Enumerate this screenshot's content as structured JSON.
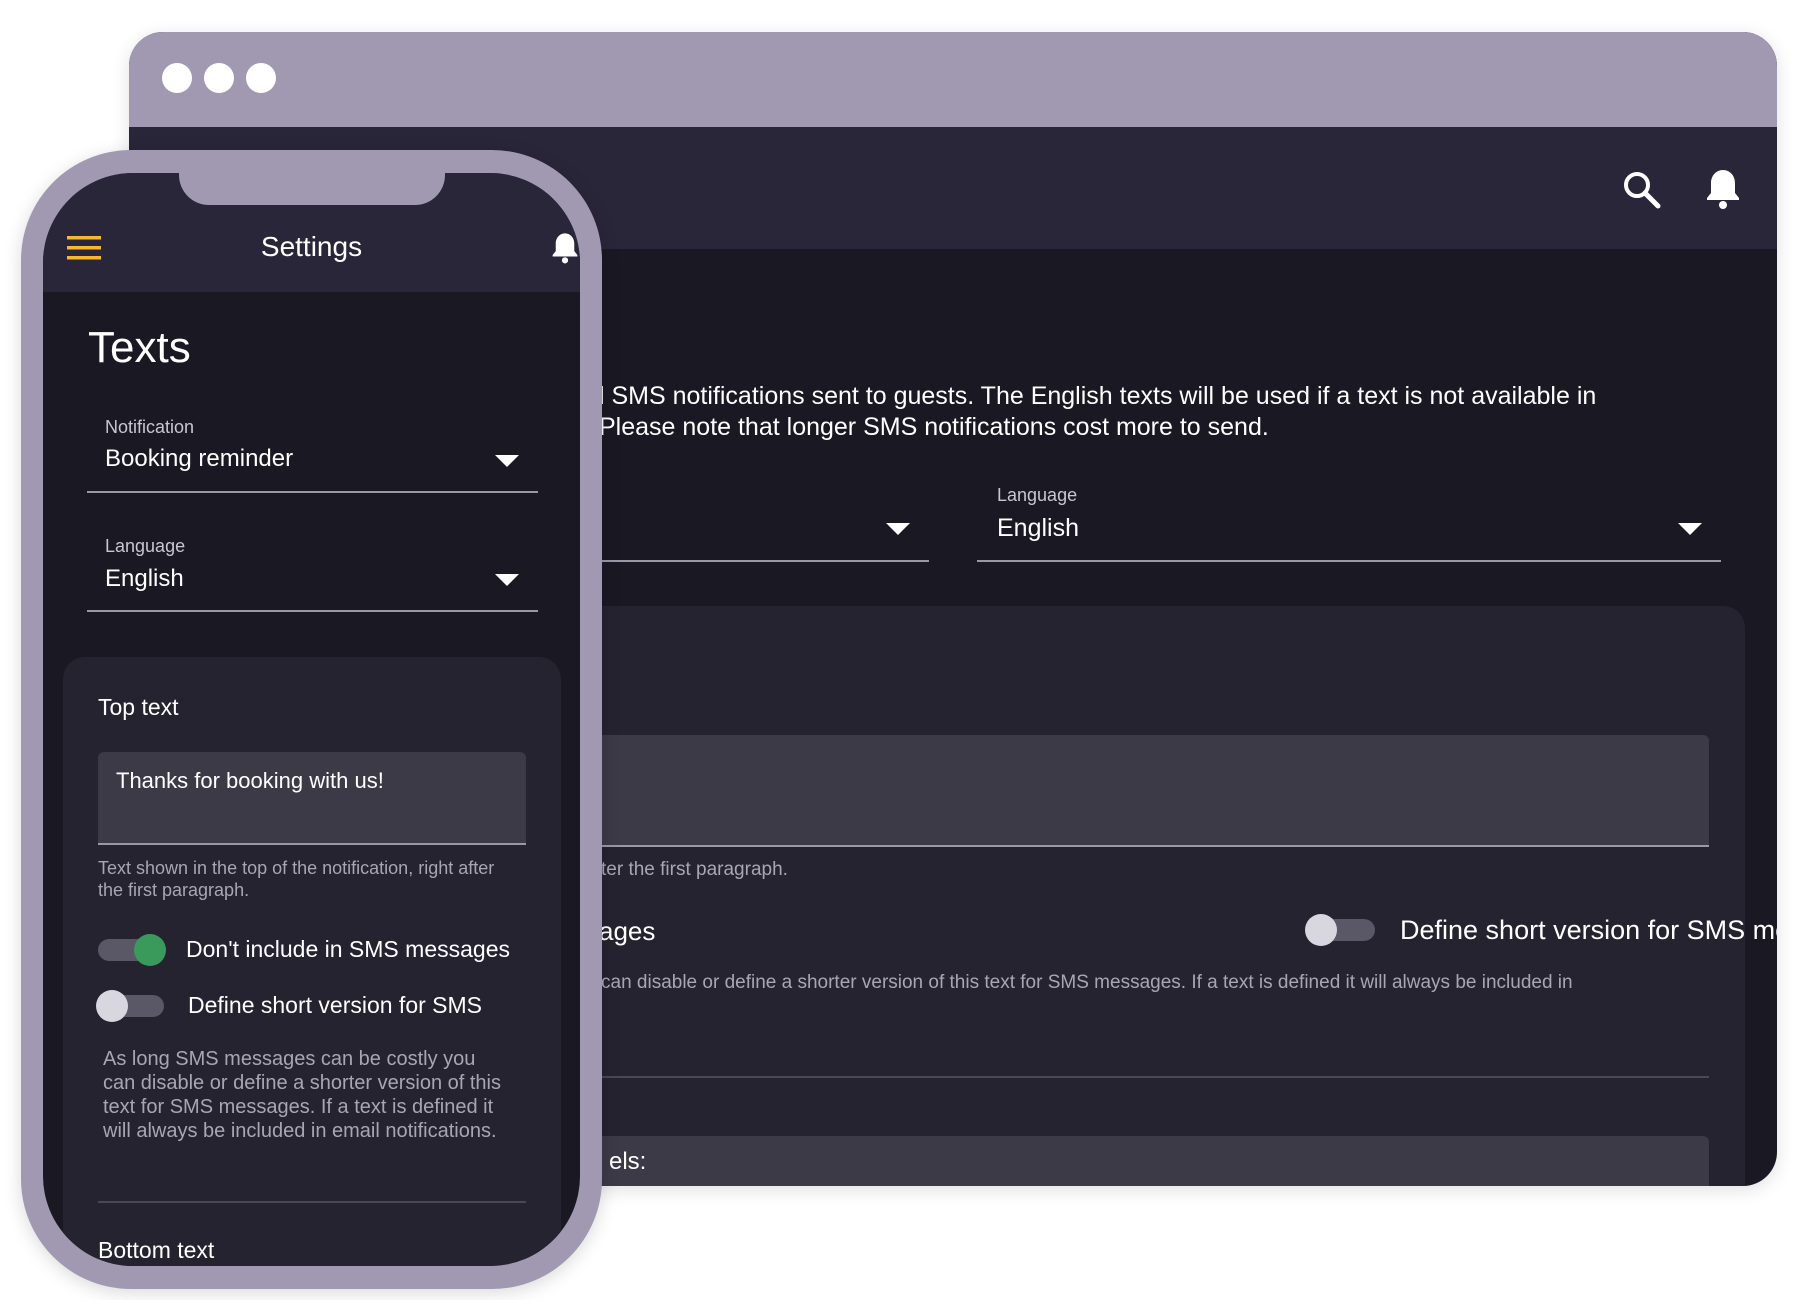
{
  "colors": {
    "frame": "#a199b2",
    "header": "#2a2639",
    "background": "#1a1822",
    "card": "#252330",
    "field": "#3d3a48",
    "accent_menu": "#f5b82e",
    "toggle_on": "#3a9a5b"
  },
  "desktop": {
    "header_icons": [
      "search-icon",
      "bell-icon"
    ],
    "description_line1": "l SMS notifications sent to guests. The English texts will be used if a text is not available in",
    "description_line2": "Please note that longer SMS notifications cost more to send.",
    "language_select": {
      "label": "Language",
      "value": "English"
    },
    "helper_text": "ter the first paragraph.",
    "dont_include_label": "ages",
    "short_version_toggle": {
      "label": "Define short version for SMS messages",
      "on": false
    },
    "sms_helper": "can disable or define a shorter version of this text for SMS messages. If a text is defined it will always be included in",
    "labels_field": "els:"
  },
  "mobile": {
    "header_title": "Settings",
    "page_title": "Texts",
    "notification_select": {
      "label": "Notification",
      "value": "Booking reminder"
    },
    "language_select": {
      "label": "Language",
      "value": "English"
    },
    "top_text": {
      "title": "Top text",
      "value": "Thanks for booking with us!",
      "helper": "Text shown in the top of the notification, right after the first paragraph."
    },
    "dont_include_toggle": {
      "label": "Don't include in SMS messages",
      "on": true
    },
    "short_version_toggle": {
      "label": "Define short version for SMS",
      "on": false
    },
    "sms_description": "As long SMS messages can be costly you can disable or define a shorter version of this text for SMS messages. If a text is defined it will always be included in email notifications.",
    "bottom_text_title": "Bottom text"
  }
}
